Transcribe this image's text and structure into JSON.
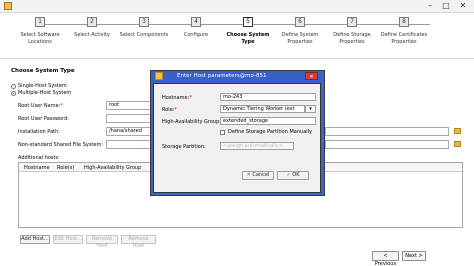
{
  "window": {
    "title": ""
  },
  "steps": [
    {
      "num": "1",
      "label1": "Select Software",
      "label2": "Locations"
    },
    {
      "num": "2",
      "label1": "Select Activity",
      "label2": ""
    },
    {
      "num": "3",
      "label1": "Select Components",
      "label2": ""
    },
    {
      "num": "4",
      "label1": "Configure",
      "label2": ""
    },
    {
      "num": "5",
      "label1": "Choose System",
      "label2": "Type"
    },
    {
      "num": "6",
      "label1": "Define System",
      "label2": "Properties"
    },
    {
      "num": "7",
      "label1": "Define Storage",
      "label2": "Properties"
    },
    {
      "num": "8",
      "label1": "Define Certificates",
      "label2": "Properties"
    }
  ],
  "section": {
    "title": "Choose System Type"
  },
  "options": {
    "single": "Single-Host System",
    "multiple": "Multiple-Host System"
  },
  "form": {
    "root_user_name_label": "Root User Name:",
    "root_user_name_value": "root",
    "root_user_password_label": "Root User Password:",
    "install_path_label": "Installation Path:",
    "install_path_value": "/hana/shared",
    "nonstd_label": "Non-standard Shared File System:",
    "additional_hosts_label": "Additional hosts:"
  },
  "hosts_table": {
    "columns": [
      "Hostname",
      "Role(s)",
      "High-Availability Group"
    ]
  },
  "host_buttons": {
    "add": "Add Host...",
    "edit": "Edit Host...",
    "remove": "Remove Host",
    "remove_all": "Remove Host"
  },
  "dialog": {
    "title": "Enter Host parameters@mo-851",
    "hostname_label": "Hostname:",
    "hostname_value": "mo-243",
    "role_label": "Role:",
    "role_value": "Dynamic Tiering Worker (ext",
    "ha_group_label": "High-Availability Group:",
    "ha_group_value": "extended_storage",
    "checkbox_label": "Define Storage Partition Manually",
    "storage_partition_label": "Storage Partition:",
    "storage_partition_placeholder": "<assign automatically>",
    "cancel": "Cancel",
    "ok": "OK"
  },
  "nav": {
    "previous": "< Previous",
    "next": "Next >"
  },
  "colors": {
    "dialog_title_bar": "#3a60c6"
  }
}
